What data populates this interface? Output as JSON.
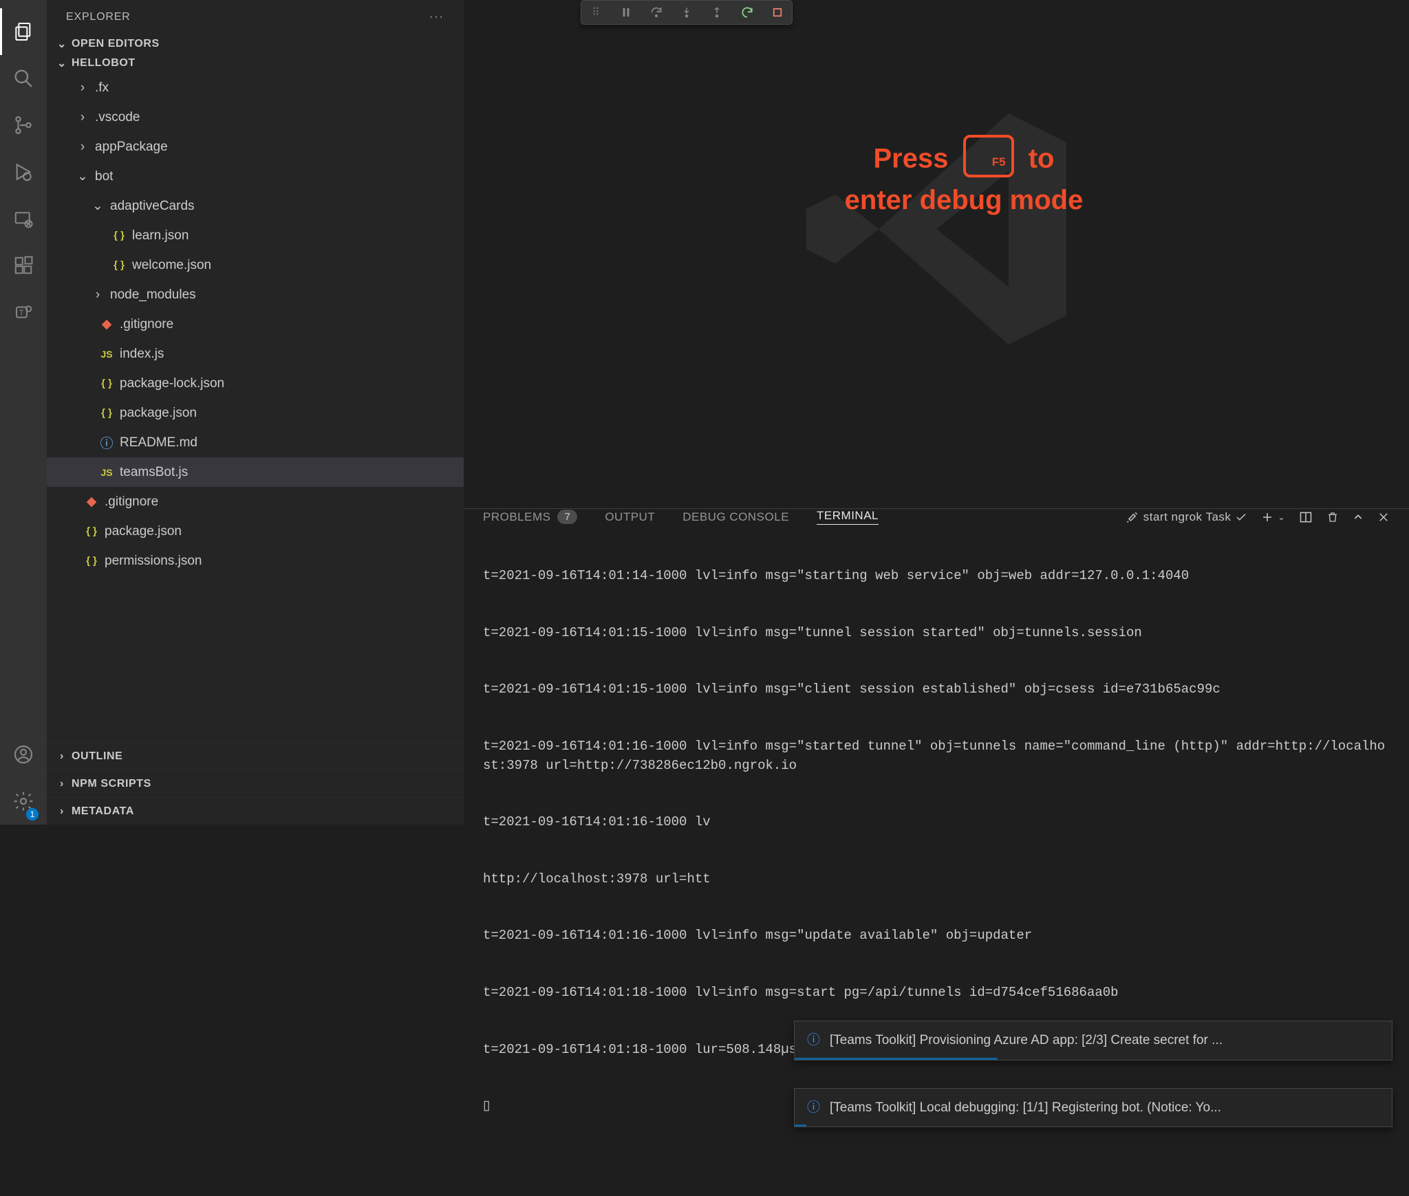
{
  "sidebar": {
    "title": "EXPLORER",
    "open_editors": "OPEN EDITORS",
    "project": "HELLOBOT",
    "tree": {
      "fx": ".fx",
      "vscode": ".vscode",
      "appPackage": "appPackage",
      "bot": "bot",
      "adaptiveCards": "adaptiveCards",
      "learn": "learn.json",
      "welcome": "welcome.json",
      "node_modules": "node_modules",
      "gitignore_bot": ".gitignore",
      "index": "index.js",
      "package_lock": "package-lock.json",
      "package_bot": "package.json",
      "readme": "README.md",
      "teamsBot": "teamsBot.js",
      "gitignore_root": ".gitignore",
      "package_root": "package.json",
      "permissions": "permissions.json"
    },
    "outline": "OUTLINE",
    "npm": "NPM SCRIPTS",
    "metadata": "METADATA"
  },
  "hint": {
    "line1_a": "Press",
    "key": "F5",
    "line1_b": "to",
    "line2": "enter debug mode"
  },
  "panel": {
    "problems": "PROBLEMS",
    "problems_count": "7",
    "output": "OUTPUT",
    "debug_console": "DEBUG CONSOLE",
    "terminal": "TERMINAL",
    "task": "start ngrok Task"
  },
  "terminal_lines": [
    "t=2021-09-16T14:01:14-1000 lvl=info msg=\"starting web service\" obj=web addr=127.0.0.1:4040",
    "t=2021-09-16T14:01:15-1000 lvl=info msg=\"tunnel session started\" obj=tunnels.session",
    "t=2021-09-16T14:01:15-1000 lvl=info msg=\"client session established\" obj=csess id=e731b65ac99c",
    "t=2021-09-16T14:01:16-1000 lvl=info msg=\"started tunnel\" obj=tunnels name=\"command_line (http)\" addr=http://localhost:3978 url=http://738286ec12b0.ngrok.io",
    "t=2021-09-16T14:01:16-1000 lv",
    "http://localhost:3978 url=htt",
    "t=2021-09-16T14:01:16-1000 lvl=info msg=\"update available\" obj=updater",
    "t=2021-09-16T14:01:18-1000 lvl=info msg=start pg=/api/tunnels id=d754cef51686aa0b",
    "t=2021-09-16T14:01:18-1000 lur=508.148µs",
    "▯"
  ],
  "toasts": {
    "t1": "[Teams Toolkit] Provisioning Azure AD app: [2/3] Create secret for ...",
    "t2": "[Teams Toolkit] Local debugging: [1/1] Registering bot. (Notice: Yo..."
  },
  "badge": {
    "settings": "1"
  }
}
